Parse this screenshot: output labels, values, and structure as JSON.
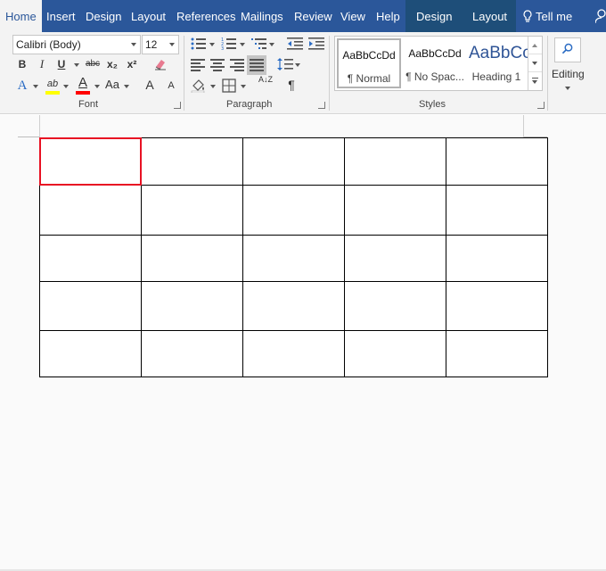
{
  "tabs": [
    {
      "label": "Home"
    },
    {
      "label": "Insert"
    },
    {
      "label": "Design"
    },
    {
      "label": "Layout"
    },
    {
      "label": "References"
    },
    {
      "label": "Mailings"
    },
    {
      "label": "Review"
    },
    {
      "label": "View"
    },
    {
      "label": "Help"
    }
  ],
  "table_tools_tabs": [
    {
      "label": "Design"
    },
    {
      "label": "Layout"
    }
  ],
  "tell_me": "Tell me",
  "font": {
    "name": "Calibri (Body)",
    "size": "12",
    "bold": "B",
    "italic": "I",
    "underline": "U",
    "strikethrough": "abc",
    "subscript": "x₂",
    "superscript": "x²",
    "text_effects": "A",
    "highlight": "ab",
    "font_color": "A",
    "change_case": "Aa",
    "grow": "A",
    "shrink": "A",
    "group_label": "Font"
  },
  "paragraph": {
    "show_marks": "¶",
    "sort": "A↓Z",
    "group_label": "Paragraph"
  },
  "styles": {
    "items": [
      {
        "sample": "AaBbCcDd",
        "name": "¶ Normal"
      },
      {
        "sample": "AaBbCcDd",
        "name": "¶ No Spac..."
      },
      {
        "sample": "AaBbCc",
        "name": "Heading 1"
      }
    ],
    "group_label": "Styles"
  },
  "editing": {
    "label": "Editing"
  },
  "table": {
    "rows": 5,
    "cols": 5
  },
  "colors": {
    "brand": "#2b579a",
    "selection": "#e81123",
    "highlight": "#ffff00",
    "font_color": "#ff0000",
    "heading": "#2f5496"
  }
}
